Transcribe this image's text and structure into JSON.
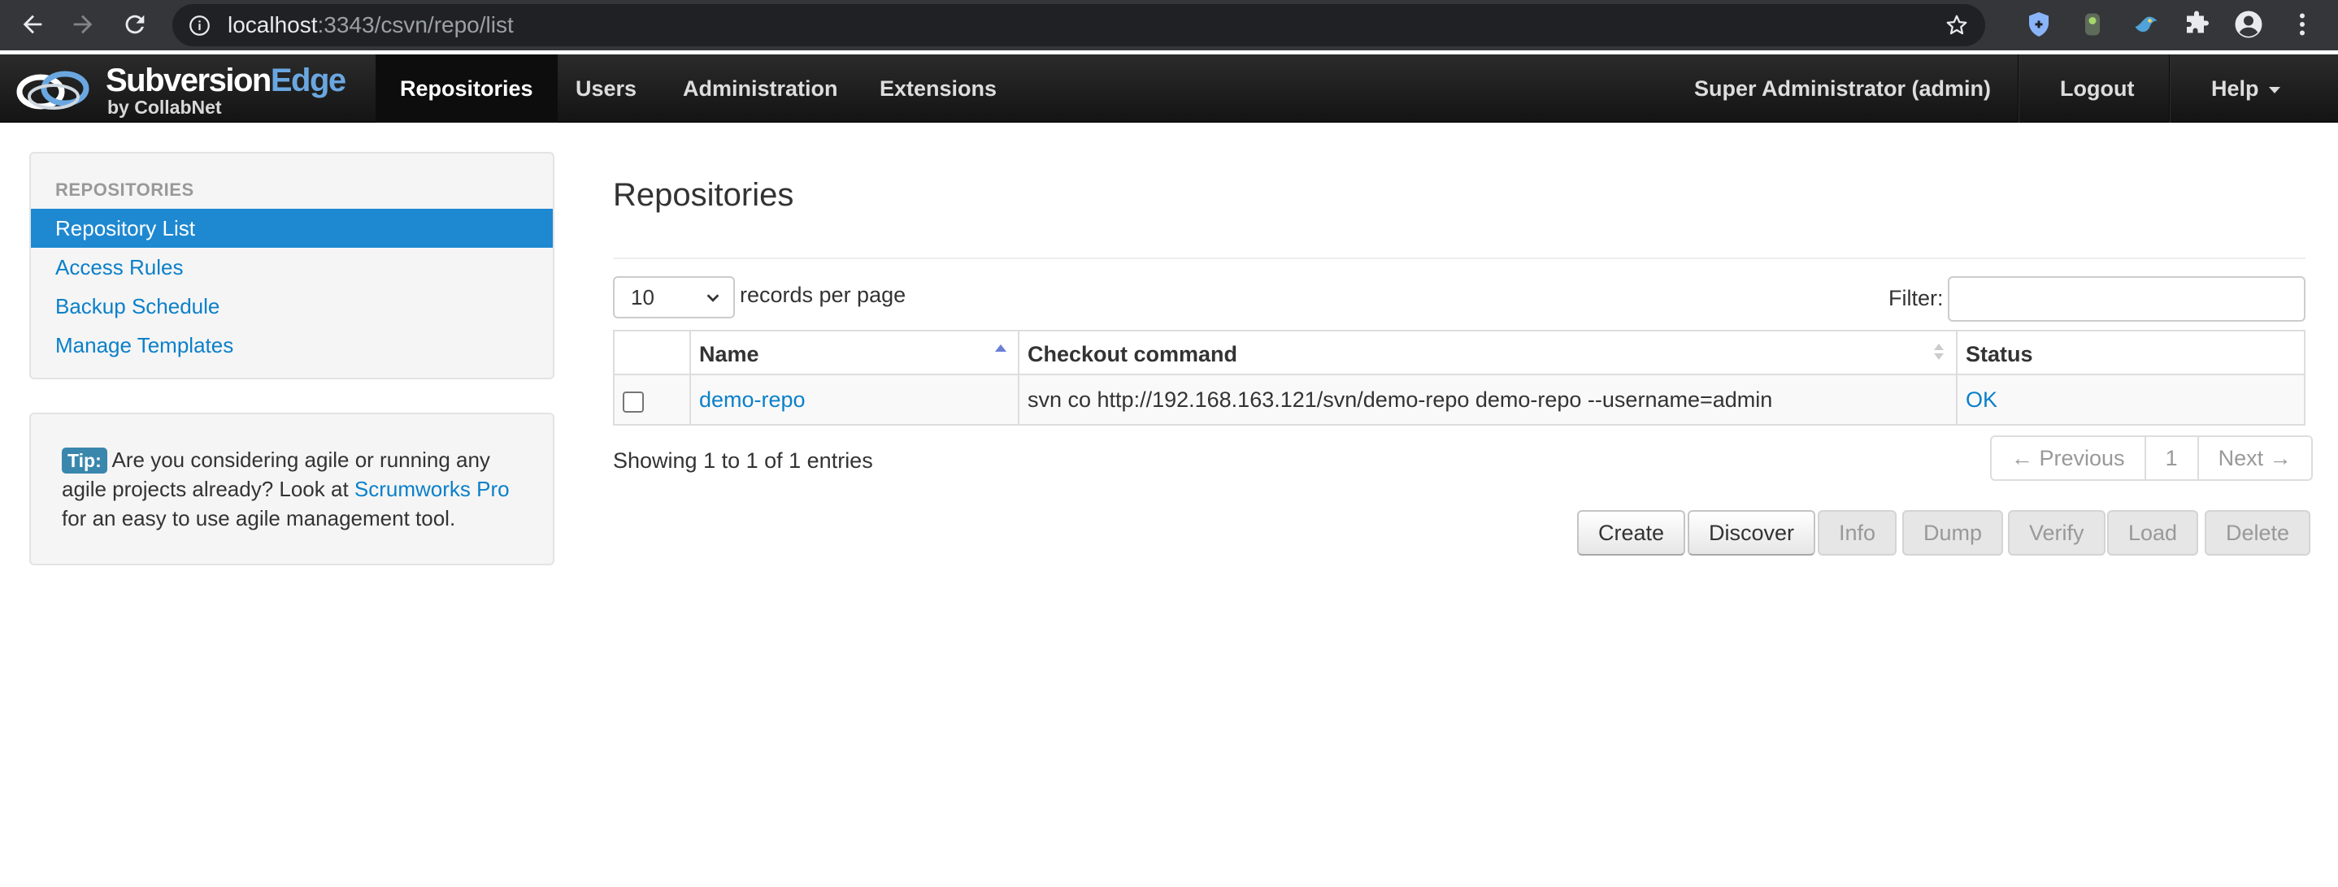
{
  "browser": {
    "url_host": "localhost",
    "url_rest": ":3343/csvn/repo/list"
  },
  "app": {
    "logo": {
      "brand_main": "Subversion",
      "brand_accent": "Edge",
      "byline": "by CollabNet"
    },
    "nav": [
      {
        "label": "Repositories",
        "active": true
      },
      {
        "label": "Users",
        "active": false
      },
      {
        "label": "Administration",
        "active": false
      },
      {
        "label": "Extensions",
        "active": false
      }
    ],
    "user_label": "Super Administrator (admin)",
    "logout_label": "Logout",
    "help_label": "Help"
  },
  "sidebar": {
    "header": "REPOSITORIES",
    "items": [
      {
        "label": "Repository List",
        "active": true
      },
      {
        "label": "Access Rules",
        "active": false
      },
      {
        "label": "Backup Schedule",
        "active": false
      },
      {
        "label": "Manage Templates",
        "active": false
      }
    ]
  },
  "tip": {
    "label": "Tip:",
    "text_before": "Are you considering agile or running any agile projects already? Look at",
    "link": "Scrumworks Pro",
    "text_after": "for an easy to use agile management tool."
  },
  "main": {
    "title": "Repositories",
    "per_page_value": "10",
    "per_page_label": "records per page",
    "filter_label": "Filter:",
    "filter_value": "",
    "columns": [
      "Name",
      "Checkout command",
      "Status"
    ],
    "rows": [
      {
        "name": "demo-repo",
        "checkout": "svn co http://192.168.163.121/svn/demo-repo demo-repo --username=admin",
        "status": "OK"
      }
    ],
    "showing": "Showing 1 to 1 of 1 entries",
    "pager": {
      "previous": "← Previous",
      "page": "1",
      "next": "Next →"
    },
    "actions": [
      {
        "label": "Create",
        "enabled": true
      },
      {
        "label": "Discover",
        "enabled": true
      },
      {
        "label": "Info",
        "enabled": false
      },
      {
        "label": "Dump",
        "enabled": false
      },
      {
        "label": "Verify",
        "enabled": false
      },
      {
        "label": "Load",
        "enabled": false
      },
      {
        "label": "Delete",
        "enabled": false
      }
    ]
  },
  "colors": {
    "link": "#0b80c9",
    "sidebar_active": "#1e88d1",
    "tip_badge": "#3a87ad",
    "navbar": "#1a1a1a"
  }
}
